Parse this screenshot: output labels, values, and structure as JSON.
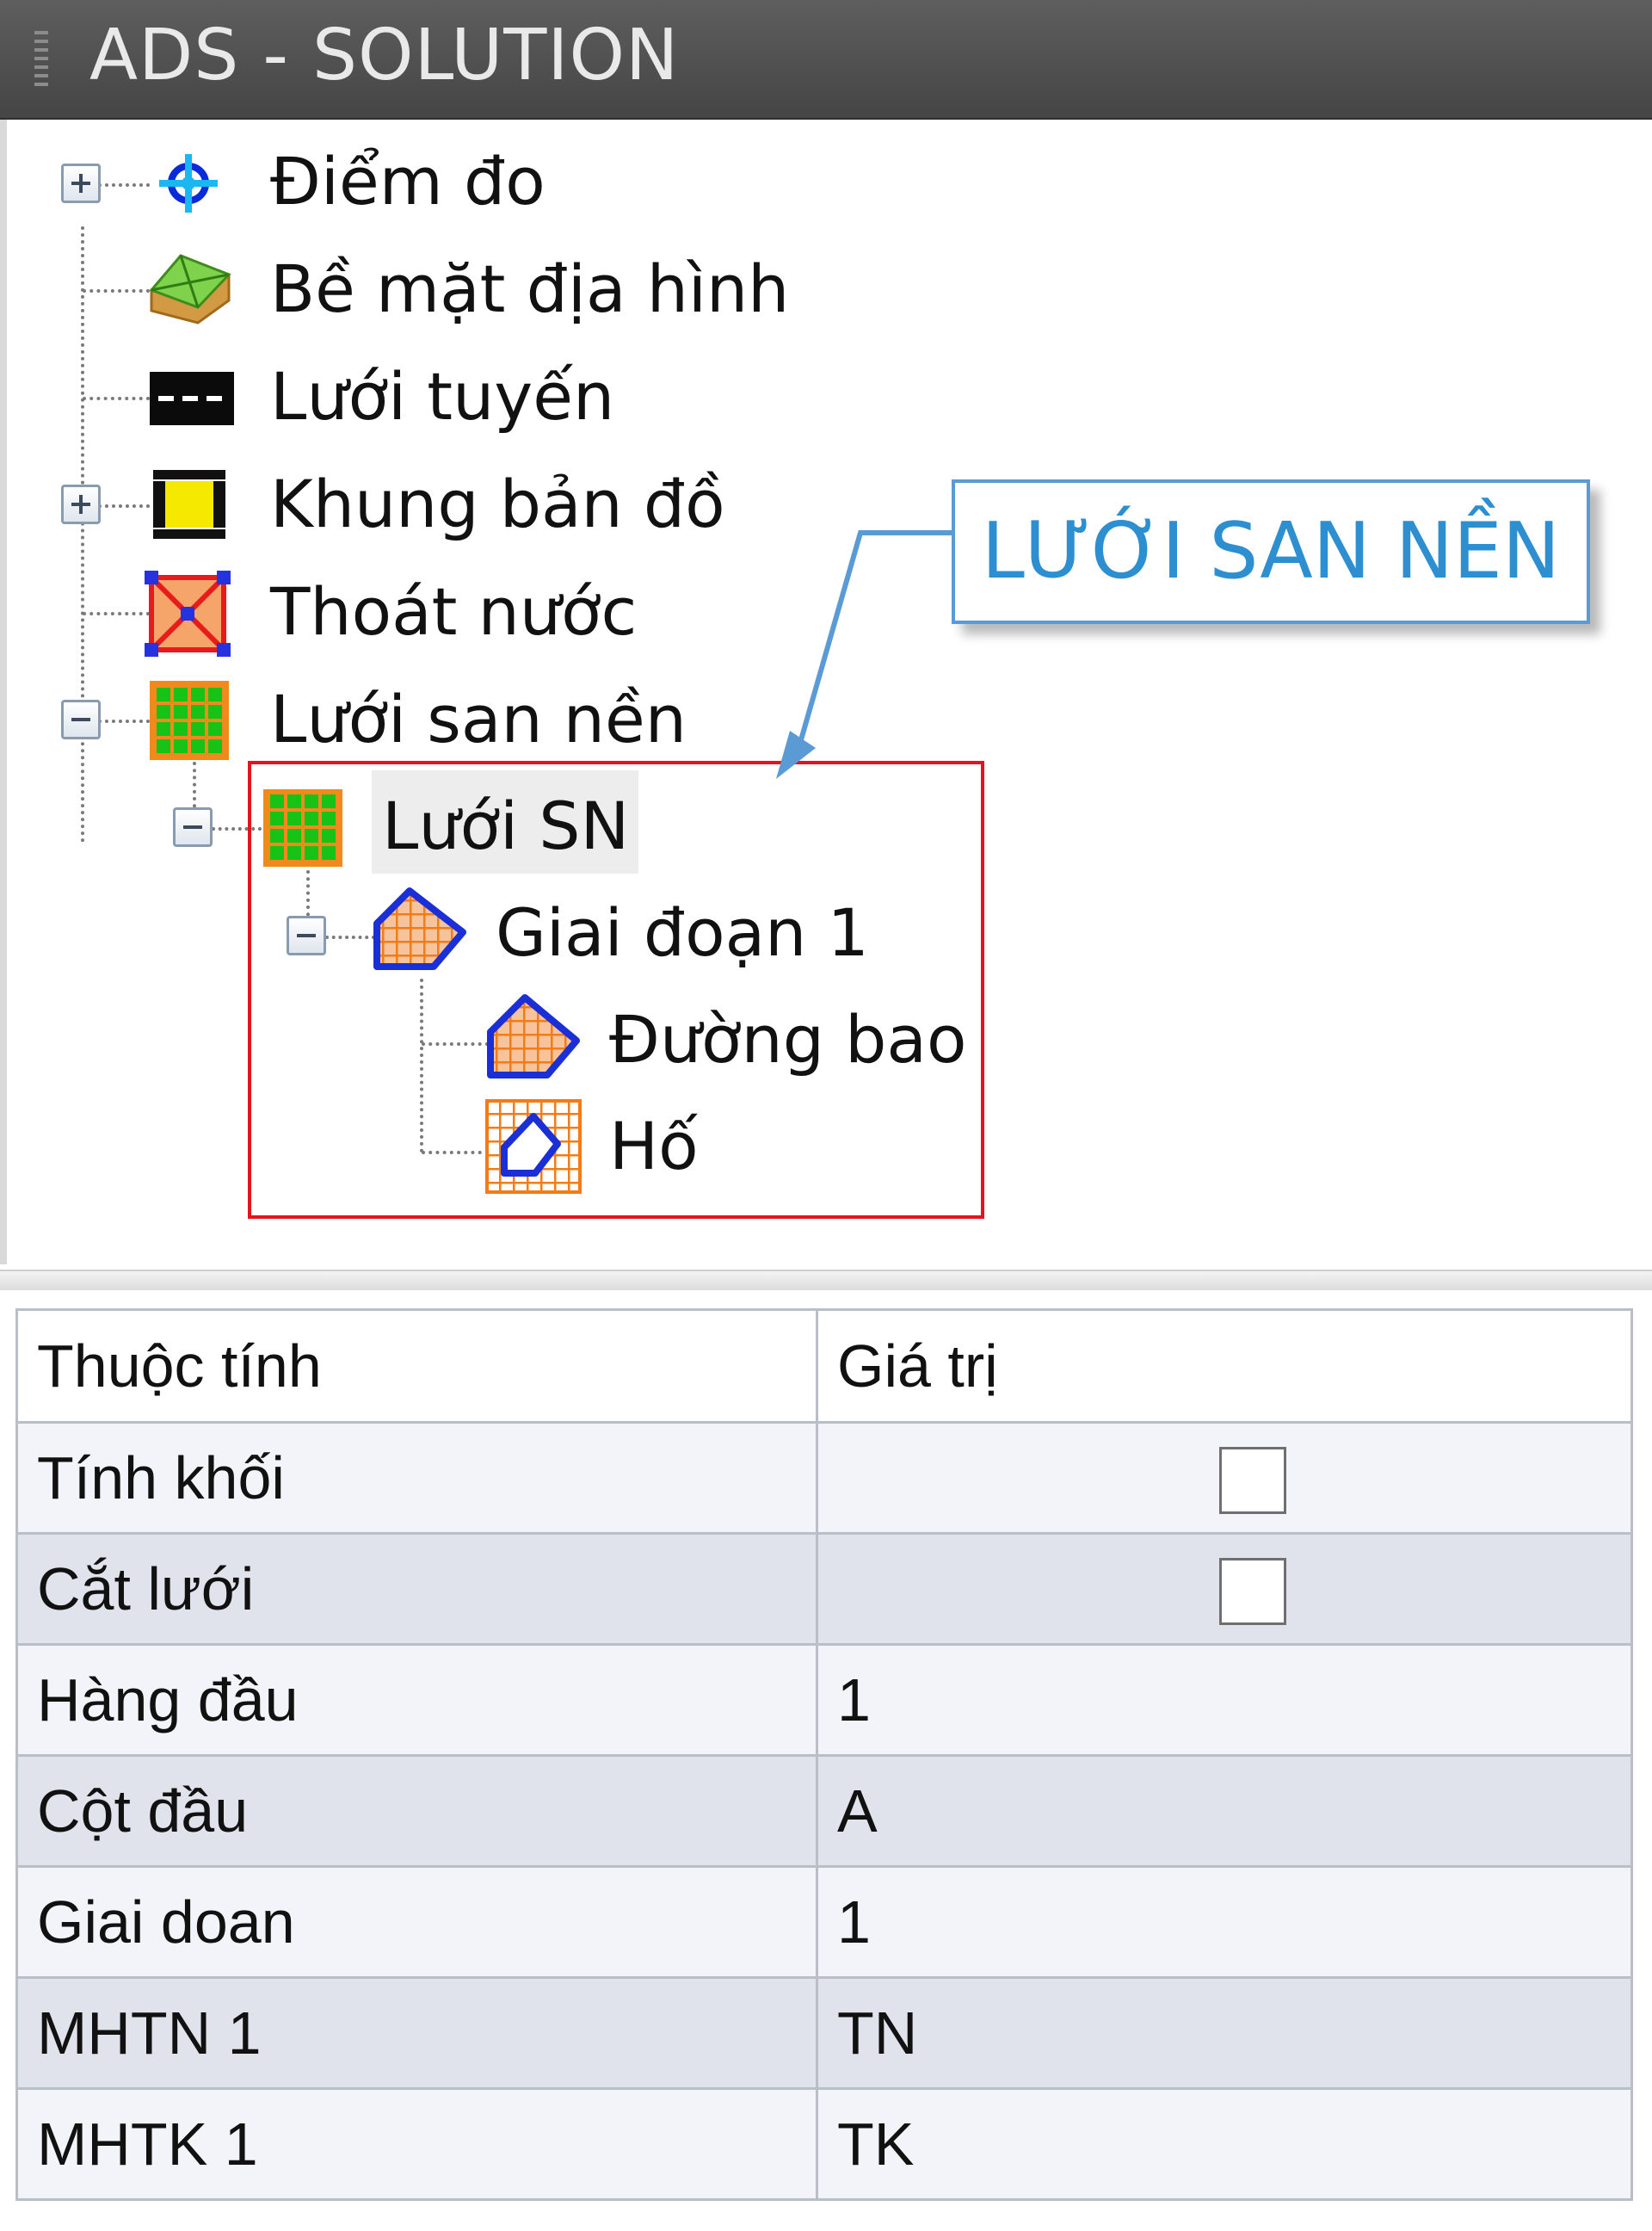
{
  "window": {
    "title": "ADS - SOLUTION"
  },
  "tree": {
    "nodes": [
      {
        "label": "Điểm đo",
        "icon": "survey-point-icon",
        "toggle": "expand"
      },
      {
        "label": "Bề mặt địa hình",
        "icon": "terrain-surface-icon"
      },
      {
        "label": "Lưới tuyến",
        "icon": "route-grid-icon"
      },
      {
        "label": "Khung bản đồ",
        "icon": "map-frame-icon",
        "toggle": "expand"
      },
      {
        "label": "Thoát nước",
        "icon": "drainage-icon"
      },
      {
        "label": "Lưới san nền",
        "icon": "leveling-grid-icon",
        "toggle": "collapse"
      },
      {
        "label": "Lưới SN",
        "icon": "leveling-grid-icon",
        "toggle": "collapse",
        "selected": true
      },
      {
        "label": "Giai đoạn 1",
        "icon": "stage-polygon-icon",
        "toggle": "collapse"
      },
      {
        "label": "Đường bao",
        "icon": "boundary-polygon-icon"
      },
      {
        "label": "Hố",
        "icon": "pit-icon"
      }
    ]
  },
  "callout": {
    "text": "LƯỚI SAN NỀN",
    "color": "#2e8fd0",
    "border_color": "#5b9bd5"
  },
  "highlight": {
    "color": "#e3141e"
  },
  "properties": {
    "headers": {
      "name": "Thuộc tính",
      "value": "Giá trị"
    },
    "rows": [
      {
        "name": "Tính khối",
        "value": "",
        "type": "checkbox",
        "checked": false
      },
      {
        "name": "Cắt lưới",
        "value": "",
        "type": "checkbox",
        "checked": false
      },
      {
        "name": "Hàng đầu",
        "value": "1"
      },
      {
        "name": "Cột đầu",
        "value": "A"
      },
      {
        "name": "Giai doan",
        "value": "1"
      },
      {
        "name": "MHTN 1",
        "value": "TN"
      },
      {
        "name": "MHTK 1",
        "value": "TK"
      }
    ]
  }
}
